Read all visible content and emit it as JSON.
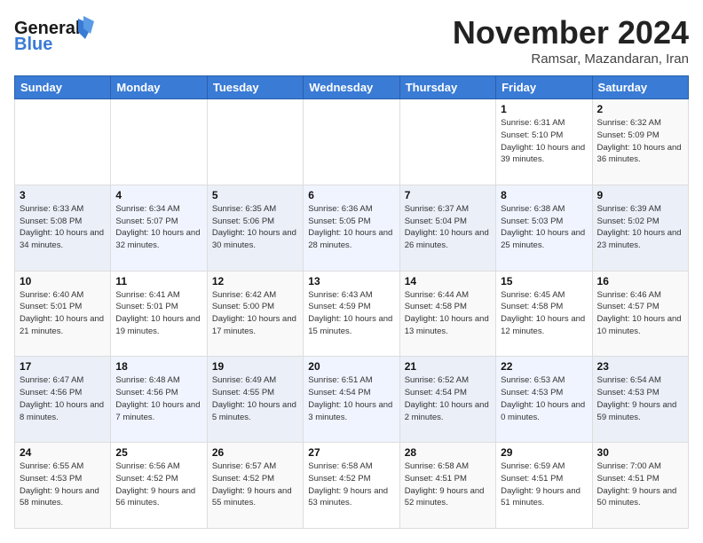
{
  "logo": {
    "line1": "General",
    "line2": "Blue"
  },
  "header": {
    "month_year": "November 2024",
    "location": "Ramsar, Mazandaran, Iran"
  },
  "weekdays": [
    "Sunday",
    "Monday",
    "Tuesday",
    "Wednesday",
    "Thursday",
    "Friday",
    "Saturday"
  ],
  "weeks": [
    [
      {
        "day": "",
        "info": ""
      },
      {
        "day": "",
        "info": ""
      },
      {
        "day": "",
        "info": ""
      },
      {
        "day": "",
        "info": ""
      },
      {
        "day": "",
        "info": ""
      },
      {
        "day": "1",
        "info": "Sunrise: 6:31 AM\nSunset: 5:10 PM\nDaylight: 10 hours and 39 minutes."
      },
      {
        "day": "2",
        "info": "Sunrise: 6:32 AM\nSunset: 5:09 PM\nDaylight: 10 hours and 36 minutes."
      }
    ],
    [
      {
        "day": "3",
        "info": "Sunrise: 6:33 AM\nSunset: 5:08 PM\nDaylight: 10 hours and 34 minutes."
      },
      {
        "day": "4",
        "info": "Sunrise: 6:34 AM\nSunset: 5:07 PM\nDaylight: 10 hours and 32 minutes."
      },
      {
        "day": "5",
        "info": "Sunrise: 6:35 AM\nSunset: 5:06 PM\nDaylight: 10 hours and 30 minutes."
      },
      {
        "day": "6",
        "info": "Sunrise: 6:36 AM\nSunset: 5:05 PM\nDaylight: 10 hours and 28 minutes."
      },
      {
        "day": "7",
        "info": "Sunrise: 6:37 AM\nSunset: 5:04 PM\nDaylight: 10 hours and 26 minutes."
      },
      {
        "day": "8",
        "info": "Sunrise: 6:38 AM\nSunset: 5:03 PM\nDaylight: 10 hours and 25 minutes."
      },
      {
        "day": "9",
        "info": "Sunrise: 6:39 AM\nSunset: 5:02 PM\nDaylight: 10 hours and 23 minutes."
      }
    ],
    [
      {
        "day": "10",
        "info": "Sunrise: 6:40 AM\nSunset: 5:01 PM\nDaylight: 10 hours and 21 minutes."
      },
      {
        "day": "11",
        "info": "Sunrise: 6:41 AM\nSunset: 5:01 PM\nDaylight: 10 hours and 19 minutes."
      },
      {
        "day": "12",
        "info": "Sunrise: 6:42 AM\nSunset: 5:00 PM\nDaylight: 10 hours and 17 minutes."
      },
      {
        "day": "13",
        "info": "Sunrise: 6:43 AM\nSunset: 4:59 PM\nDaylight: 10 hours and 15 minutes."
      },
      {
        "day": "14",
        "info": "Sunrise: 6:44 AM\nSunset: 4:58 PM\nDaylight: 10 hours and 13 minutes."
      },
      {
        "day": "15",
        "info": "Sunrise: 6:45 AM\nSunset: 4:58 PM\nDaylight: 10 hours and 12 minutes."
      },
      {
        "day": "16",
        "info": "Sunrise: 6:46 AM\nSunset: 4:57 PM\nDaylight: 10 hours and 10 minutes."
      }
    ],
    [
      {
        "day": "17",
        "info": "Sunrise: 6:47 AM\nSunset: 4:56 PM\nDaylight: 10 hours and 8 minutes."
      },
      {
        "day": "18",
        "info": "Sunrise: 6:48 AM\nSunset: 4:56 PM\nDaylight: 10 hours and 7 minutes."
      },
      {
        "day": "19",
        "info": "Sunrise: 6:49 AM\nSunset: 4:55 PM\nDaylight: 10 hours and 5 minutes."
      },
      {
        "day": "20",
        "info": "Sunrise: 6:51 AM\nSunset: 4:54 PM\nDaylight: 10 hours and 3 minutes."
      },
      {
        "day": "21",
        "info": "Sunrise: 6:52 AM\nSunset: 4:54 PM\nDaylight: 10 hours and 2 minutes."
      },
      {
        "day": "22",
        "info": "Sunrise: 6:53 AM\nSunset: 4:53 PM\nDaylight: 10 hours and 0 minutes."
      },
      {
        "day": "23",
        "info": "Sunrise: 6:54 AM\nSunset: 4:53 PM\nDaylight: 9 hours and 59 minutes."
      }
    ],
    [
      {
        "day": "24",
        "info": "Sunrise: 6:55 AM\nSunset: 4:53 PM\nDaylight: 9 hours and 58 minutes."
      },
      {
        "day": "25",
        "info": "Sunrise: 6:56 AM\nSunset: 4:52 PM\nDaylight: 9 hours and 56 minutes."
      },
      {
        "day": "26",
        "info": "Sunrise: 6:57 AM\nSunset: 4:52 PM\nDaylight: 9 hours and 55 minutes."
      },
      {
        "day": "27",
        "info": "Sunrise: 6:58 AM\nSunset: 4:52 PM\nDaylight: 9 hours and 53 minutes."
      },
      {
        "day": "28",
        "info": "Sunrise: 6:58 AM\nSunset: 4:51 PM\nDaylight: 9 hours and 52 minutes."
      },
      {
        "day": "29",
        "info": "Sunrise: 6:59 AM\nSunset: 4:51 PM\nDaylight: 9 hours and 51 minutes."
      },
      {
        "day": "30",
        "info": "Sunrise: 7:00 AM\nSunset: 4:51 PM\nDaylight: 9 hours and 50 minutes."
      }
    ]
  ]
}
